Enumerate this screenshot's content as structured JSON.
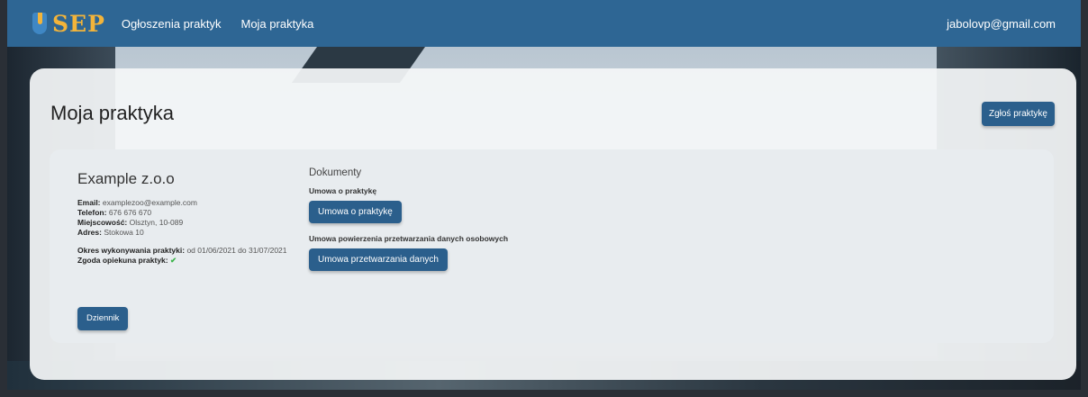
{
  "nav": {
    "logo_text": "SEP",
    "links": [
      "Ogłoszenia praktyk",
      "Moja praktyka"
    ],
    "user_email": "jabolovp@gmail.com"
  },
  "page": {
    "title": "Moja praktyka",
    "report_button": "Zgłoś praktykę"
  },
  "internship": {
    "company_name": "Example z.o.o",
    "email_label": "Email:",
    "email": "examplezoo@example.com",
    "phone_label": "Telefon:",
    "phone": "676 676 670",
    "city_label": "Miejscowość:",
    "city": "Olsztyn, 10-089",
    "address_label": "Adres:",
    "address": "Stokowa 10",
    "period_label": "Okres wykonywania praktyki:",
    "period": "od 01/06/2021 do 31/07/2021",
    "approval_label": "Zgoda opiekuna praktyk:",
    "approval_icon": "check-icon",
    "diary_button": "Dziennik"
  },
  "documents": {
    "title": "Dokumenty",
    "items": [
      {
        "label": "Umowa o praktykę",
        "button": "Umowa o praktykę"
      },
      {
        "label": "Umowa powierzenia przetwarzania danych osobowych",
        "button": "Umowa przetwarzania danych"
      }
    ]
  },
  "colors": {
    "navbar": "#2e6694",
    "button": "#2b5f8c",
    "logo": "#f3b43a",
    "check": "#3bb44a"
  }
}
